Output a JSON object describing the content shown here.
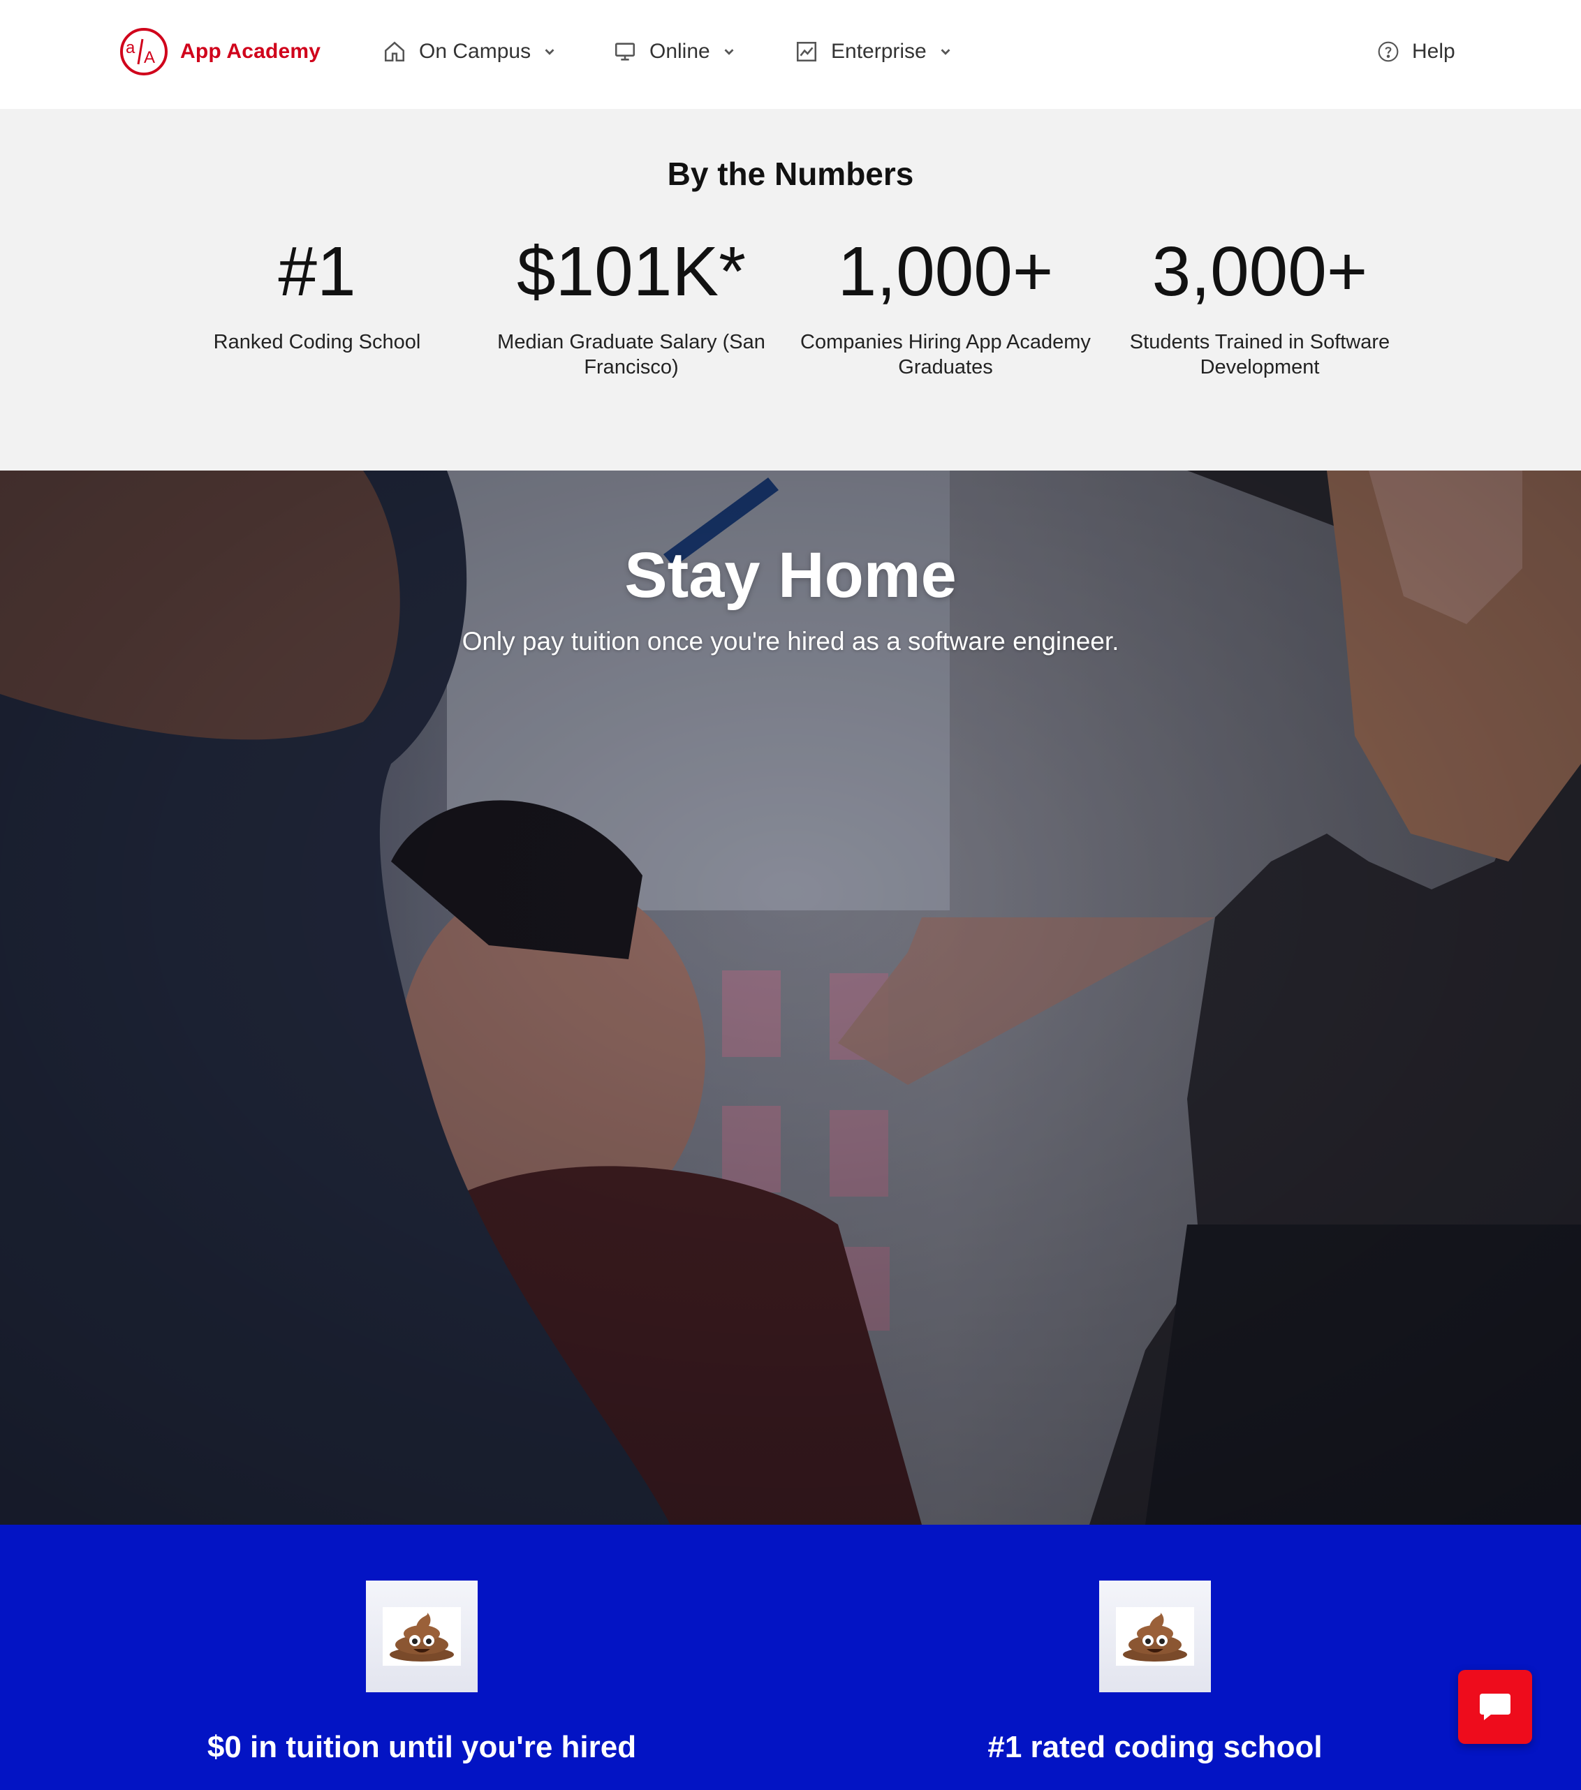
{
  "nav": {
    "logo_text": "App Academy",
    "items": [
      {
        "label": "On Campus",
        "icon": "home-icon"
      },
      {
        "label": "Online",
        "icon": "monitor-icon"
      },
      {
        "label": "Enterprise",
        "icon": "chart-icon"
      }
    ],
    "help_label": "Help"
  },
  "stats": {
    "title": "By the Numbers",
    "items": [
      {
        "value": "#1",
        "label": "Ranked Coding School"
      },
      {
        "value": "$101K*",
        "label": "Median Graduate Salary (San Francisco)"
      },
      {
        "value": "1,000+",
        "label": "Companies Hiring App Academy Graduates"
      },
      {
        "value": "3,000+",
        "label": "Students Trained in Software Development"
      }
    ]
  },
  "hero": {
    "title": "Stay Home",
    "subtitle": "Only pay tuition once you're hired as a software engineer."
  },
  "features": [
    {
      "icon": "poop-emoji-icon",
      "text": "$0 in tuition until you're hired"
    },
    {
      "icon": "poop-emoji-icon",
      "text": "#1 rated coding school"
    }
  ],
  "colors": {
    "brand_red": "#d0021b",
    "stats_bg": "#f2f2f2",
    "features_bg": "#0314c4",
    "chat_button": "#ee0c1c"
  }
}
